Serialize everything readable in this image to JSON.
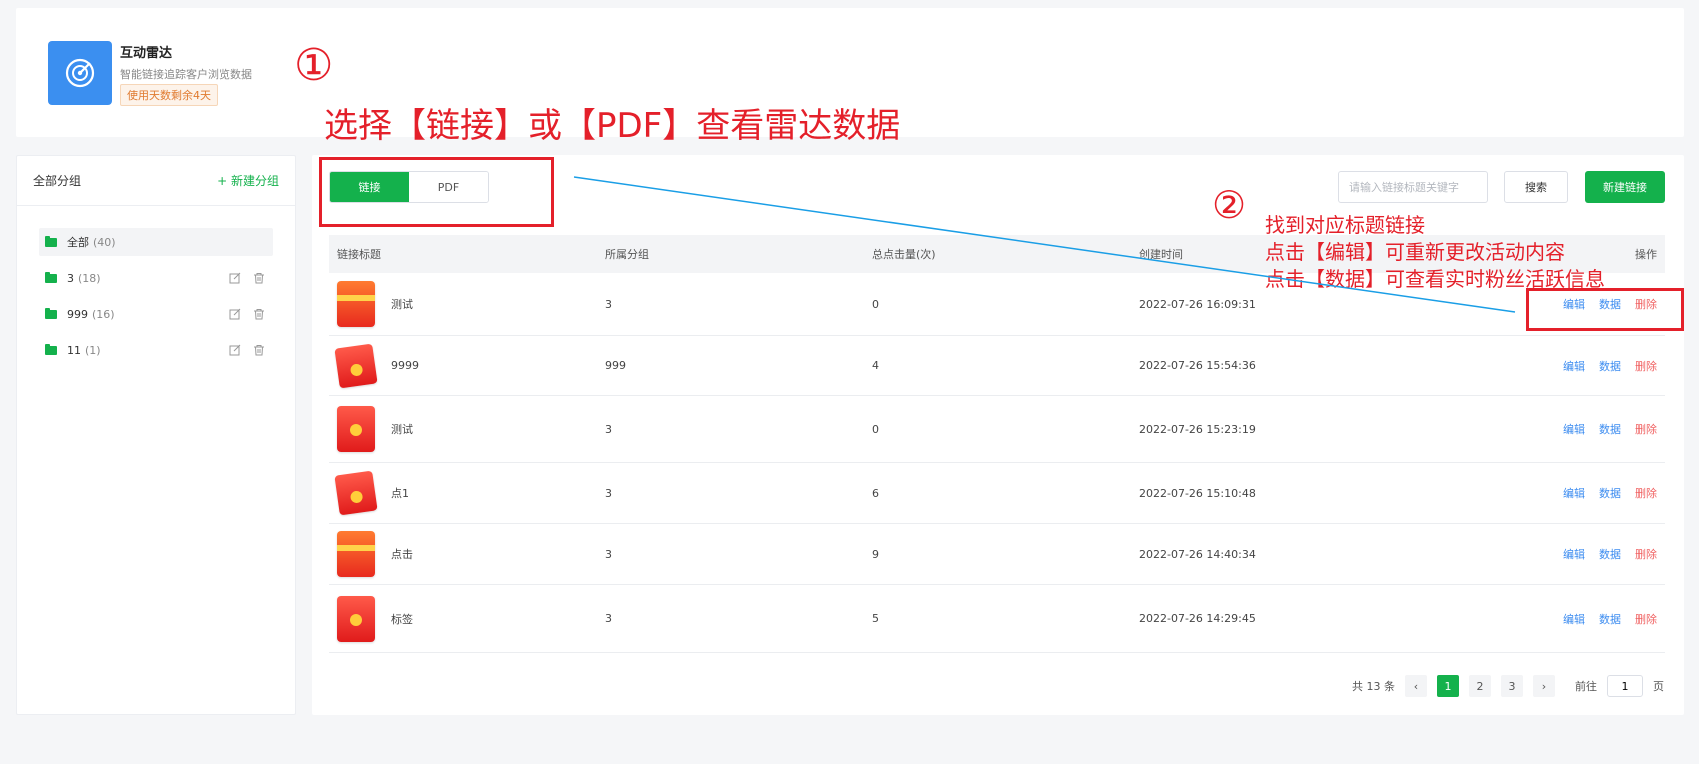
{
  "app": {
    "title": "互动雷达",
    "description": "智能链接追踪客户浏览数据",
    "badge": "使用天数剩余4天"
  },
  "annotations": {
    "step1_num": "①",
    "step1_text": "选择【链接】或【PDF】查看雷达数据",
    "step2_num": "②",
    "step2_line1": "找到对应标题链接",
    "step2_line2": "点击【编辑】可重新更改活动内容",
    "step2_line3": "点击【数据】可查看实时粉丝活跃信息",
    "color": "#e4202a",
    "arrow_color": "#1a9ee6"
  },
  "sidebar": {
    "title": "全部分组",
    "new_group": "+ 新建分组",
    "groups": [
      {
        "name": "全部",
        "count": "(40)"
      },
      {
        "name": "3",
        "count": "(18)"
      },
      {
        "name": "999",
        "count": "(16)"
      },
      {
        "name": "11",
        "count": "(1)"
      }
    ]
  },
  "toolbar": {
    "tabs": [
      {
        "label": "链接"
      },
      {
        "label": "PDF"
      }
    ],
    "search_placeholder": "请输入链接标题关键字",
    "search_label": "搜索",
    "new_link_label": "新建链接"
  },
  "table": {
    "headers": [
      "链接标题",
      "所属分组",
      "总点击量(次)",
      "创建时间",
      "操作"
    ],
    "actions": {
      "edit": "编辑",
      "data": "数据",
      "delete": "删除"
    },
    "rows": [
      {
        "title": "测试",
        "group": "3",
        "clicks": "0",
        "created": "2022-07-26 16:09:31",
        "thumb": "gift-box"
      },
      {
        "title": "9999",
        "group": "999",
        "clicks": "4",
        "created": "2022-07-26 15:54:36",
        "thumb": "red-envelopes"
      },
      {
        "title": "测试",
        "group": "3",
        "clicks": "0",
        "created": "2022-07-26 15:23:19",
        "thumb": "red-envelope"
      },
      {
        "title": "点1",
        "group": "3",
        "clicks": "6",
        "created": "2022-07-26 15:10:48",
        "thumb": "red-envelopes"
      },
      {
        "title": "点击",
        "group": "3",
        "clicks": "9",
        "created": "2022-07-26 14:40:34",
        "thumb": "gift-box"
      },
      {
        "title": "标签",
        "group": "3",
        "clicks": "5",
        "created": "2022-07-26 14:29:45",
        "thumb": "red-envelope"
      }
    ]
  },
  "pagination": {
    "total": "共 13 条",
    "pages": [
      "1",
      "2",
      "3"
    ],
    "current": "1",
    "goto_prefix": "前往",
    "goto_value": "1",
    "goto_suffix": "页",
    "prev": "‹",
    "next": "›"
  },
  "colors": {
    "brand": "#14b14c",
    "link": "#3c8cf0",
    "danger": "#f06060"
  }
}
